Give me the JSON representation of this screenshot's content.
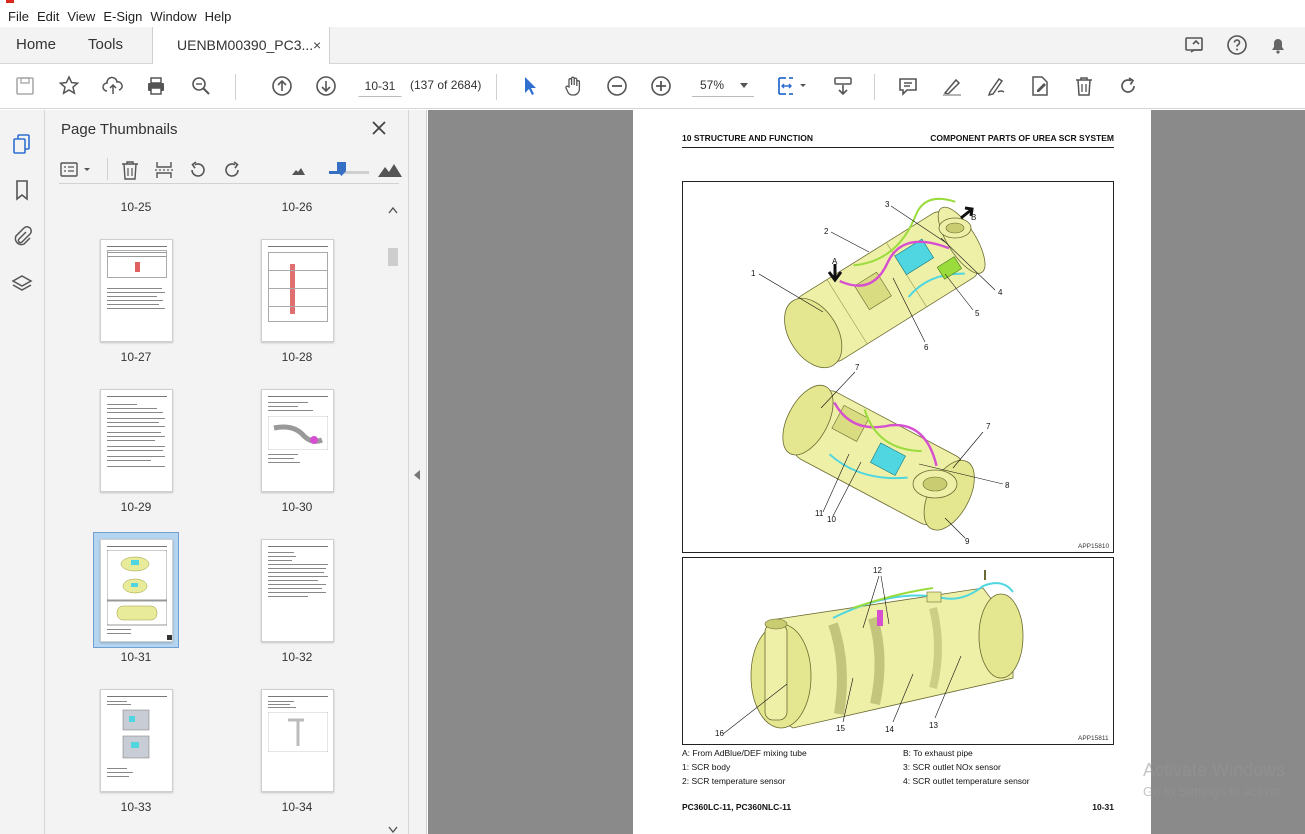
{
  "menu": [
    "File",
    "Edit",
    "View",
    "E-Sign",
    "Window",
    "Help"
  ],
  "tabs": {
    "home": "Home",
    "tools": "Tools",
    "document": "UENBM00390_PC3...",
    "close_glyph": "×"
  },
  "toolbar": {
    "page_input": "10-31",
    "page_count": "(137 of 2684)",
    "zoom": "57%"
  },
  "panel": {
    "title": "Page Thumbnails",
    "thumbnails": [
      {
        "label": "10-25"
      },
      {
        "label": "10-26"
      },
      {
        "label": "10-27"
      },
      {
        "label": "10-28"
      },
      {
        "label": "10-29"
      },
      {
        "label": "10-30"
      },
      {
        "label": "10-31",
        "selected": true
      },
      {
        "label": "10-32"
      },
      {
        "label": "10-33"
      },
      {
        "label": "10-34"
      }
    ]
  },
  "document": {
    "header_left": "10 STRUCTURE AND FUNCTION",
    "header_right": "COMPONENT PARTS OF UREA SCR SYSTEM",
    "figure1_code": "APP15810",
    "figure2_code": "APP15811",
    "callouts_fig1": [
      "1",
      "2",
      "3",
      "4",
      "5",
      "6",
      "7",
      "7",
      "8",
      "9",
      "10",
      "11",
      "A",
      "B"
    ],
    "callouts_fig2": [
      "12",
      "13",
      "14",
      "15",
      "16"
    ],
    "captions": {
      "a": "A: From AdBlue/DEF mixing tube",
      "b": "B: To exhaust pipe",
      "c1": "1: SCR body",
      "c3": "3: SCR outlet NOx sensor",
      "c2": "2: SCR temperature sensor",
      "c4": "4: SCR outlet temperature sensor"
    },
    "footer_left": "PC360LC-11, PC360NLC-11",
    "footer_right": "10-31"
  },
  "watermark": {
    "line1": "Activate Windows",
    "line2": "Go to Settings to activat"
  },
  "colors": {
    "accent": "#3670c4",
    "chrome": "#f3f3f3",
    "doc_bg": "#8a8a8a",
    "part_yellow": "#e8ec9a",
    "part_cyan": "#4fd6e0",
    "part_magenta": "#d64fd0",
    "part_green": "#9adc3c"
  }
}
